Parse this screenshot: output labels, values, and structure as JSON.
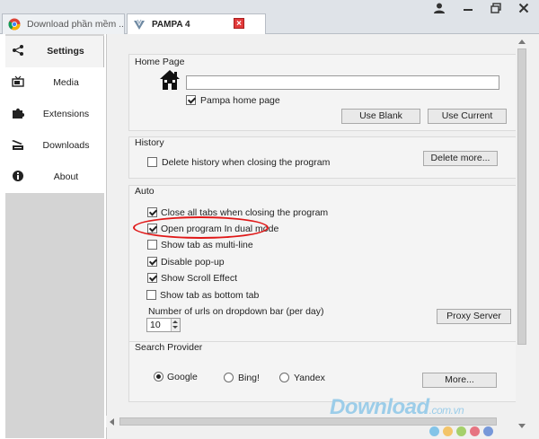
{
  "tabs": [
    {
      "label": "Download phần mềm ...",
      "active": false
    },
    {
      "label": "PAMPA 4",
      "active": true
    }
  ],
  "close_tab_symbol": "×",
  "window_controls": [
    "user-icon",
    "minimize-icon",
    "restore-icon",
    "close-icon"
  ],
  "nav": [
    {
      "label": "Settings",
      "icon": "share-icon",
      "selected": true
    },
    {
      "label": "Media",
      "icon": "tv-icon",
      "selected": false
    },
    {
      "label": "Extensions",
      "icon": "puzzle-icon",
      "selected": false
    },
    {
      "label": "Downloads",
      "icon": "download-tray-icon",
      "selected": false
    },
    {
      "label": "About",
      "icon": "info-icon",
      "selected": false
    }
  ],
  "home_page": {
    "title": "Home Page",
    "url_value": "",
    "pampa_home_label": "Pampa home page",
    "pampa_home_checked": true,
    "use_blank_label": "Use Blank",
    "use_current_label": "Use Current"
  },
  "history": {
    "title": "History",
    "delete_on_close_label": "Delete history when closing the program",
    "delete_on_close_checked": false,
    "delete_more_label": "Delete more..."
  },
  "auto": {
    "title": "Auto",
    "options": [
      {
        "label": "Close all tabs when closing the program",
        "checked": true
      },
      {
        "label": "Open program In dual mode",
        "checked": true
      },
      {
        "label": "Show tab as multi-line",
        "checked": false
      },
      {
        "label": "Disable pop-up",
        "checked": true
      },
      {
        "label": "Show Scroll Effect",
        "checked": true
      },
      {
        "label": "Show tab as bottom tab",
        "checked": false
      }
    ],
    "urls_label": "Number of urls on dropdown bar (per day)",
    "urls_value": "10",
    "proxy_label": "Proxy Server"
  },
  "search_provider": {
    "title": "Search Provider",
    "options": [
      {
        "label": "Google",
        "selected": true
      },
      {
        "label": "Bing!",
        "selected": false
      },
      {
        "label": "Yandex",
        "selected": false
      }
    ],
    "more_label": "More..."
  },
  "watermark": {
    "text": "Download",
    "tld": ".com.vn"
  },
  "colors": {
    "accent_red": "#e01818",
    "watermark_blue": "#9ccde9",
    "dots": [
      "#5fb6e6",
      "#f4b63c",
      "#8cc63f",
      "#e34b5c",
      "#4f7bd1"
    ]
  }
}
